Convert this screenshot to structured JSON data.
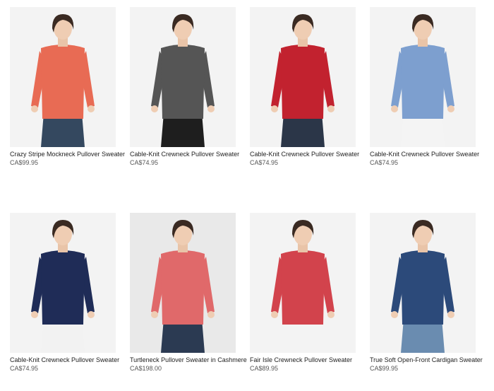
{
  "products": [
    {
      "name": "Crazy Stripe Mockneck Pullover Sweater",
      "price": "CA$99.95",
      "sweater_color": "#e86b54",
      "pants_color": "#34485f",
      "bg": "#f3f3f3"
    },
    {
      "name": "Cable-Knit Crewneck Pullover Sweater",
      "price": "CA$74.95",
      "sweater_color": "#555555",
      "pants_color": "#1e1e1e",
      "bg": "#f3f3f3"
    },
    {
      "name": "Cable-Knit Crewneck Pullover Sweater",
      "price": "CA$74.95",
      "sweater_color": "#c2222f",
      "pants_color": "#2b3648",
      "bg": "#f3f3f3"
    },
    {
      "name": "Cable-Knit Crewneck Pullover Sweater",
      "price": "CA$74.95",
      "sweater_color": "#7d9fcf",
      "pants_color": "#f4f4f4",
      "bg": "#f3f3f3"
    },
    {
      "name": "Cable-Knit Crewneck Pullover Sweater",
      "price": "CA$74.95",
      "sweater_color": "#1f2c57",
      "pants_color": "#f2f2f2",
      "bg": "#f3f3f3"
    },
    {
      "name": "Turtleneck Pullover Sweater in Cashmere",
      "price": "CA$198.00",
      "sweater_color": "#e0696a",
      "pants_color": "#2b3a52",
      "bg": "#e9e9e9"
    },
    {
      "name": "Fair Isle Crewneck Pullover Sweater",
      "price": "CA$89.95",
      "sweater_color": "#d2434c",
      "pants_color": "#f3f3f3",
      "bg": "#f3f3f3"
    },
    {
      "name": "True Soft Open-Front Cardigan Sweater",
      "price": "CA$99.95",
      "sweater_color": "#2c4a7a",
      "pants_color": "#6a8cb0",
      "bg": "#f3f3f3"
    }
  ]
}
